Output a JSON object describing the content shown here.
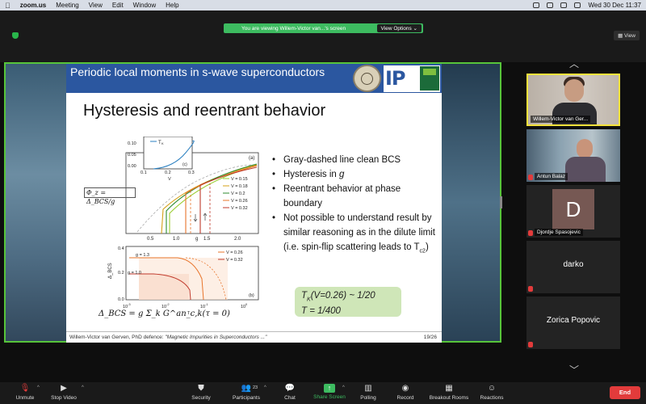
{
  "menubar": {
    "app": "zoom.us",
    "items": [
      "Meeting",
      "View",
      "Edit",
      "Window",
      "Help"
    ],
    "clock": "Wed 30 Dec  11:37"
  },
  "zoom": {
    "share_banner": "You are viewing Willem-Victor van...'s screen",
    "view_options": "View Options",
    "view_button": "View"
  },
  "slide": {
    "section_title": "Periodic local moments in s-wave superconductors",
    "title": "Hysteresis and reentrant behavior",
    "bullets": [
      "Gray-dashed line clean BCS",
      "Hysteresis in ",
      "Reentrant behavior at phase boundary",
      "Not possible to understand result by similar reasoning as in the dilute limit (i.e. spin-flip scattering leads to T"
    ],
    "bullet_italic": "g",
    "bullet_sub": "c2",
    "bullet_end": ")",
    "box_line1": "T",
    "box_line1_sub": "K",
    "box_line1_rest": "(V=0.26) ~ 1/20",
    "box_line2": "T = 1/400",
    "formula_phi": "Φ_z = Δ_BCS/g",
    "formula_delta": "Δ_BCS = g Σ_k G^an_c,k(τ = 0)",
    "footer_left": "Willem-Victor van Gerven, PhD defence:",
    "footer_italic": "\"Magnetic Impurities in Superconductors ...\"",
    "footer_right": "19/26"
  },
  "chart_data": [
    {
      "type": "line",
      "panel": "(a)",
      "xlabel": "g",
      "ylabel": "",
      "x_ticks": [
        "0.5",
        "1.0",
        "1.5",
        "2.0"
      ],
      "legend": [
        "V = 0.15",
        "V = 0.18",
        "V = 0.2",
        "V = 0.26",
        "V = 0.32"
      ],
      "colors": [
        "#9acd32",
        "#d4a017",
        "#2e8b2e",
        "#e8742a",
        "#c0392b"
      ],
      "arrow_labels": [
        "γ",
        "γ",
        "γ"
      ]
    },
    {
      "type": "line",
      "panel": "(b)",
      "xlabel": "T",
      "ylabel": "Δ_BCS",
      "y_ticks": [
        "0.0",
        "0.2",
        "0.4"
      ],
      "x_ticks": [
        "10^-3",
        "10^-2",
        "10^-1",
        "10^0"
      ],
      "legend": [
        "V = 0.26",
        "V = 0.32"
      ],
      "annotations": [
        "g = 1.3",
        "g = 1.0"
      ],
      "colors": [
        "#e8742a",
        "#c0392b"
      ]
    },
    {
      "type": "line",
      "panel": "(c)",
      "xlabel": "V",
      "legend": [
        "T_K"
      ],
      "y_ticks": [
        "0.10",
        "0.05",
        "0.00"
      ],
      "x_ticks": [
        "0.1",
        "0.2",
        "0.3"
      ],
      "colors": [
        "#2a7fc0"
      ]
    }
  ],
  "participants": [
    {
      "name": "Willem-Victor van Ger...",
      "muted": false
    },
    {
      "name": "Antun Balaz",
      "muted": true
    },
    {
      "name": "Djordje Spasojevic",
      "muted": true,
      "avatar": "D"
    },
    {
      "name": "darko",
      "muted": true
    },
    {
      "name": "Zorica Popovic",
      "muted": true
    }
  ],
  "toolbar": {
    "unmute": "Unmute",
    "stop_video": "Stop Video",
    "security": "Security",
    "participants": "Participants",
    "participants_count": "23",
    "chat": "Chat",
    "share_screen": "Share Screen",
    "polling": "Polling",
    "record": "Record",
    "breakout": "Breakout Rooms",
    "reactions": "Reactions",
    "end": "End"
  },
  "icons": {
    "apple": "apple-icon",
    "mic": "microphone-muted-icon",
    "video": "video-camera-icon",
    "shield": "shield-icon",
    "people": "people-icon",
    "chat": "chat-bubble-icon",
    "share": "share-screen-arrow-icon",
    "poll": "poll-bars-icon",
    "record": "record-dot-icon",
    "breakout": "grid-icon",
    "reactions": "smiley-icon"
  }
}
